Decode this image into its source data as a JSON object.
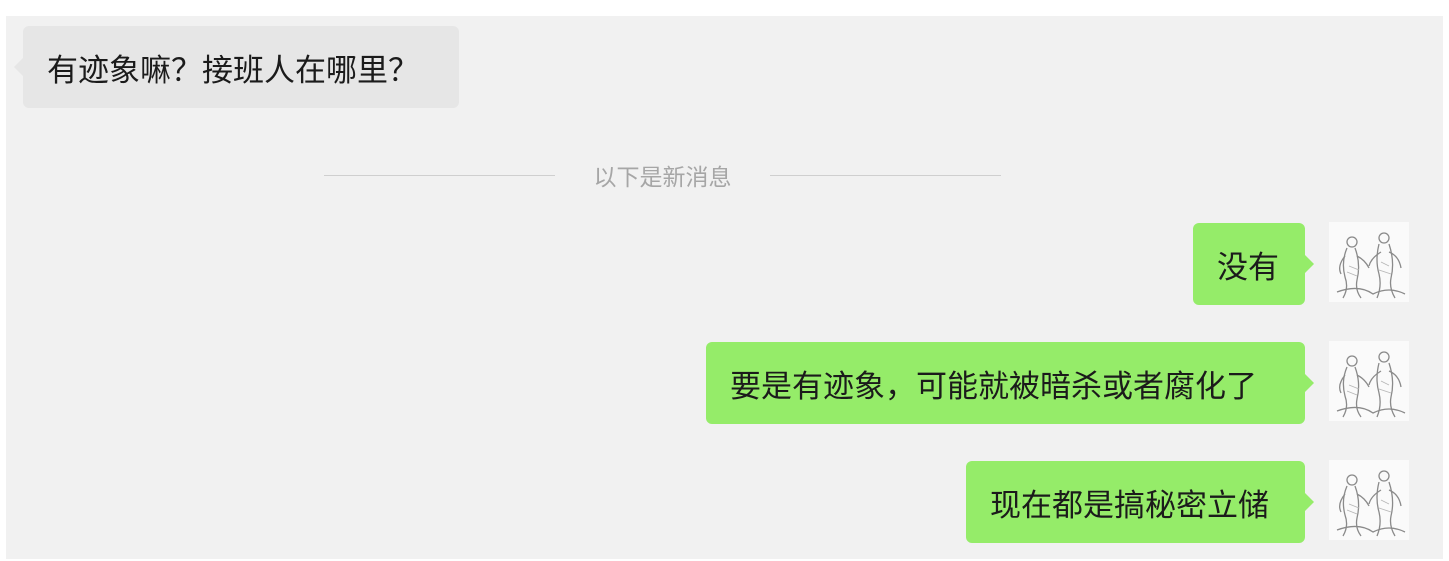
{
  "incoming_message": {
    "text": "有迹象嘛？接班人在哪里？"
  },
  "divider": {
    "label": "以下是新消息"
  },
  "outgoing_messages": [
    {
      "text": "没有"
    },
    {
      "text": "要是有迹象，可能就被暗杀或者腐化了"
    },
    {
      "text": "现在都是搞秘密立储"
    }
  ],
  "colors": {
    "chat_background": "#f1f1f1",
    "incoming_bubble": "#e6e6e6",
    "outgoing_bubble": "#95ec69",
    "divider_text": "#a6a6a6"
  },
  "avatar": {
    "icon": "sketch-figures-avatar-icon"
  }
}
